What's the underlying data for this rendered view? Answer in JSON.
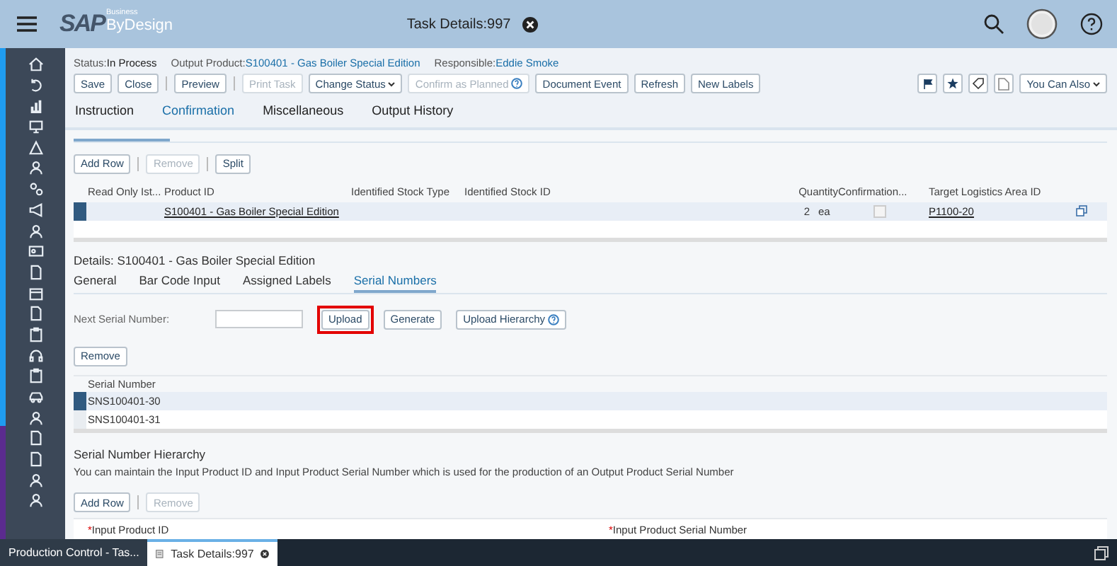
{
  "header": {
    "logo": {
      "brand": "SAP",
      "super": "Business",
      "product": "ByDesign"
    },
    "title": "Task Details:997"
  },
  "status": [
    {
      "label": "Status:",
      "value": "In Process",
      "kind": "plain"
    },
    {
      "label": "Output Product:",
      "value": "S100401 - Gas Boiler Special Edition",
      "kind": "link"
    },
    {
      "label": "Responsible:",
      "value": "Eddie Smoke",
      "kind": "link"
    }
  ],
  "toolbar": [
    [
      {
        "label": "Save",
        "disabled": false,
        "kind": "plain"
      },
      {
        "label": "Close",
        "disabled": false,
        "kind": "plain"
      }
    ],
    [
      {
        "label": "Preview",
        "disabled": false,
        "kind": "plain"
      }
    ],
    [
      {
        "label": "Print Task",
        "disabled": true,
        "kind": "plain"
      },
      {
        "label": "Change Status",
        "disabled": false,
        "kind": "menu"
      },
      {
        "label": "Confirm as Planned",
        "disabled": true,
        "kind": "help"
      },
      {
        "label": "Document Event",
        "disabled": false,
        "kind": "plain"
      },
      {
        "label": "Refresh",
        "disabled": false,
        "kind": "plain"
      },
      {
        "label": "New Labels",
        "disabled": false,
        "kind": "plain"
      }
    ]
  ],
  "you_can_also": "You Can Also",
  "tabs": [
    {
      "label": "Instruction",
      "selected": false
    },
    {
      "label": "Confirmation",
      "selected": true
    },
    {
      "label": "Miscellaneous",
      "selected": false
    },
    {
      "label": "Output History",
      "selected": false
    }
  ],
  "products": {
    "toolbar": [
      {
        "label": "Add Row",
        "disabled": false
      },
      {
        "label": "Remove",
        "disabled": true
      },
      {
        "label": "Split",
        "disabled": false
      }
    ],
    "columns": [
      "Read Only Ist...",
      "Product ID",
      "Identified Stock Type",
      "Identified Stock ID",
      "Quantity",
      "Confirmation...",
      "Target Logistics Area ID"
    ],
    "rows": [
      {
        "selected": true,
        "product_id": "S100401 - Gas Boiler Special Edition",
        "quantity": "2",
        "unit": "ea",
        "confirmed": false,
        "target_area": "P1100-20"
      }
    ]
  },
  "details": {
    "title": "Details: S100401 - Gas Boiler Special Edition",
    "tabs": [
      {
        "label": "General",
        "selected": false
      },
      {
        "label": "Bar Code Input",
        "selected": false
      },
      {
        "label": "Assigned Labels",
        "selected": false
      },
      {
        "label": "Serial Numbers",
        "selected": true
      }
    ],
    "next_serial_label": "Next Serial Number:",
    "serial_buttons": [
      {
        "label": "Upload",
        "kind": "plain",
        "highlighted": true
      },
      {
        "label": "Generate",
        "kind": "plain",
        "highlighted": false
      },
      {
        "label": "Upload Hierarchy",
        "kind": "help",
        "highlighted": false
      }
    ],
    "remove": "Remove",
    "serial_column": "Serial Number",
    "serials": [
      {
        "value": "SNS100401-30",
        "selected": true
      },
      {
        "value": "SNS100401-31",
        "selected": false
      }
    ]
  },
  "hierarchy": {
    "title": "Serial Number Hierarchy",
    "description": "You can maintain the Input Product ID and Input Product Serial Number which is used for the production of an Output Product Serial Number",
    "toolbar": [
      {
        "label": "Add Row",
        "disabled": false
      },
      {
        "label": "Remove",
        "disabled": true
      }
    ],
    "required_mark": "*",
    "columns": [
      {
        "label": "Input Product ID",
        "required": true
      },
      {
        "label": "Input Product Serial Number",
        "required": true
      }
    ]
  },
  "taskbar": [
    {
      "label": "Production Control - Tas...",
      "selected": false,
      "kind": "plain"
    },
    {
      "label": "Task Details:997",
      "selected": true,
      "kind": "document"
    }
  ]
}
